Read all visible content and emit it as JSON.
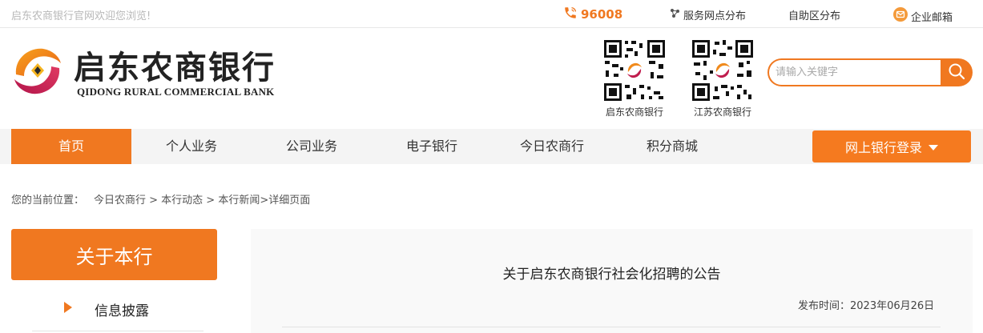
{
  "topbar": {
    "welcome": "启东农商银行官网欢迎您浏览!",
    "hotline": "96008",
    "links": [
      {
        "label": "服务网点分布"
      },
      {
        "label": "自助区分布"
      },
      {
        "label": "企业邮箱"
      }
    ]
  },
  "header": {
    "logo_cn": "启东农商银行",
    "logo_en": "QIDONG RURAL COMMERCIAL BANK",
    "qrcodes": [
      {
        "label": "启东农商银行"
      },
      {
        "label": "江苏农商银行"
      }
    ],
    "search": {
      "placeholder": "请输入关键字"
    }
  },
  "nav": {
    "items": [
      {
        "label": "首页",
        "active": true
      },
      {
        "label": "个人业务"
      },
      {
        "label": "公司业务"
      },
      {
        "label": "电子银行"
      },
      {
        "label": "今日农商行"
      },
      {
        "label": "积分商城"
      }
    ],
    "login_label": "网上银行登录"
  },
  "breadcrumb": {
    "label": "您的当前位置：",
    "path": "今日农商行 > 本行动态 > 本行新闻>详细页面"
  },
  "sidebar": {
    "title": "关于本行",
    "items": [
      {
        "label": "信息披露"
      }
    ]
  },
  "article": {
    "title": "关于启东农商银行社会化招聘的公告",
    "date": "发布时间：2023年06月26日"
  },
  "colors": {
    "accent": "#f07820",
    "nav_bg": "#f4f4f4",
    "article_bg": "#f9f9f9"
  }
}
